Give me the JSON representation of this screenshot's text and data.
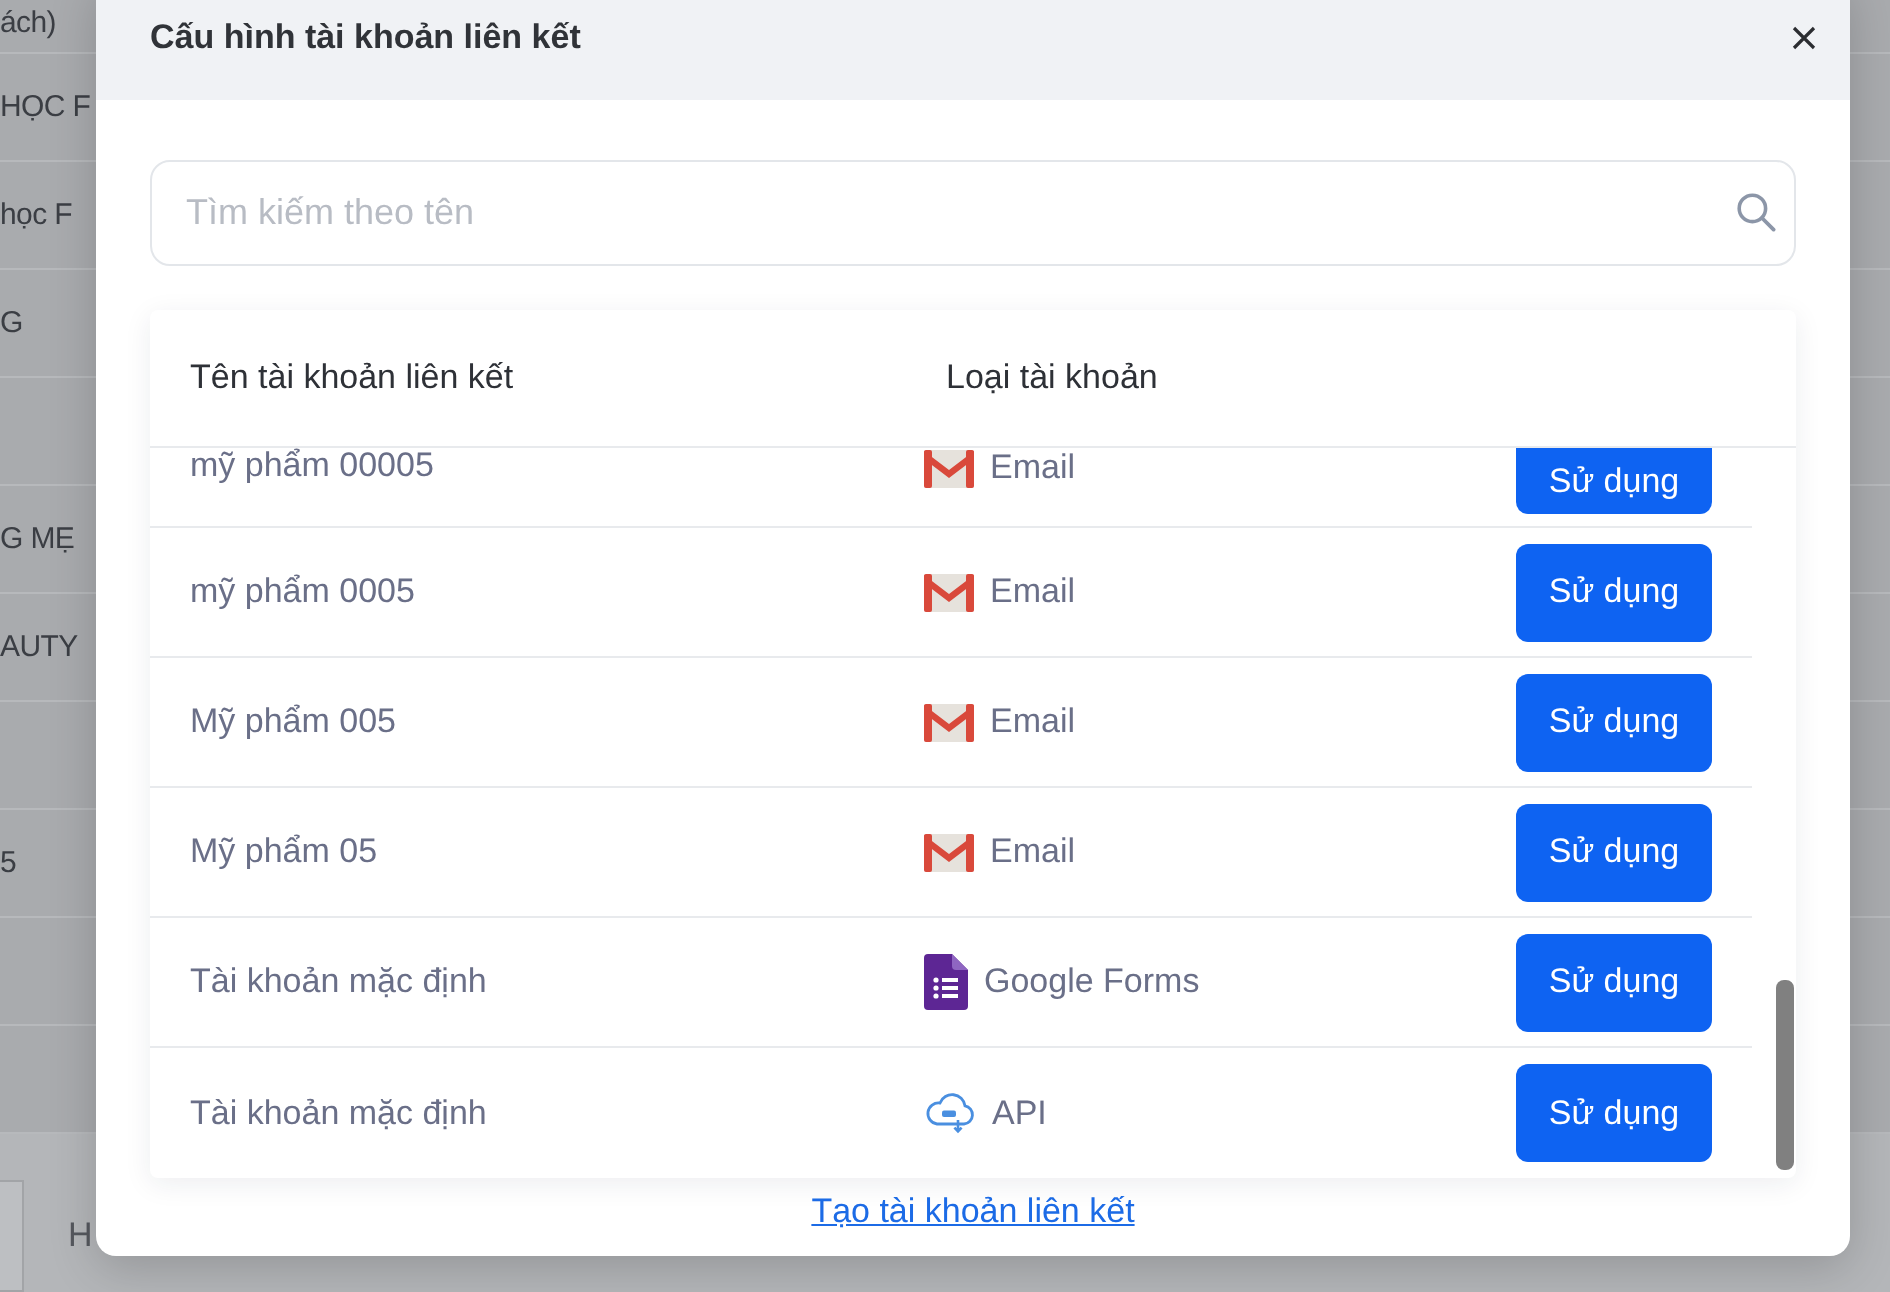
{
  "background_page": {
    "rows": [
      {
        "text": "ách)"
      },
      {
        "text": "HỌC F"
      },
      {
        "text": "học F"
      },
      {
        "text": "G"
      },
      {},
      {
        "text": "G MẸ"
      },
      {
        "text": "AUTY"
      },
      {},
      {
        "text": "5"
      },
      {},
      {}
    ],
    "footer": {
      "text": "H"
    }
  },
  "dialog": {
    "title": "Cấu hình tài khoản liên kết",
    "search": {
      "placeholder": "Tìm kiếm theo tên"
    },
    "table": {
      "columns": [
        "Tên tài khoản liên kết",
        "Loại tài khoản"
      ],
      "rows": [
        {
          "name": "mỹ phẩm 00005",
          "type": {
            "kind": "email",
            "label": "Email"
          },
          "action": "Sử dụng"
        },
        {
          "name": "mỹ phẩm 0005",
          "type": {
            "kind": "email",
            "label": "Email"
          },
          "action": "Sử dụng"
        },
        {
          "name": "Mỹ phẩm 005",
          "type": {
            "kind": "email",
            "label": "Email"
          },
          "action": "Sử dụng"
        },
        {
          "name": "Mỹ phẩm 05",
          "type": {
            "kind": "email",
            "label": "Email"
          },
          "action": "Sử dụng"
        },
        {
          "name": "Tài khoản mặc định",
          "type": {
            "kind": "forms",
            "label": "Google Forms"
          },
          "action": "Sử dụng"
        },
        {
          "name": "Tài khoản mặc định",
          "type": {
            "kind": "api",
            "label": "API"
          },
          "action": "Sử dụng"
        }
      ]
    },
    "create_link": "Tạo tài khoản liên kết"
  }
}
